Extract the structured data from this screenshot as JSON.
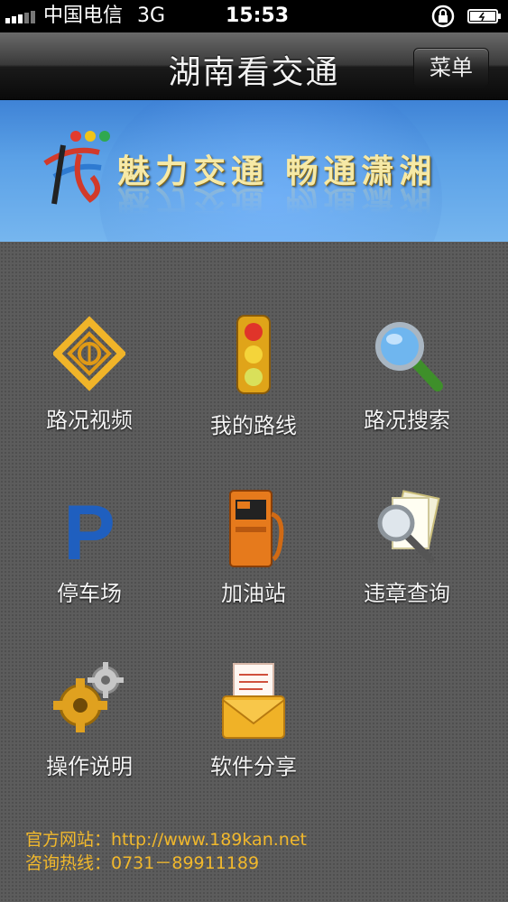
{
  "status_bar": {
    "carrier": "中国电信",
    "network": "3G",
    "time": "15:53"
  },
  "nav": {
    "title": "湖南看交通",
    "menu_label": "菜单"
  },
  "banner": {
    "slogan": "魅力交通 畅通潇湘"
  },
  "grid": {
    "items": [
      {
        "label": "路况视频",
        "icon": "video-camera-icon"
      },
      {
        "label": "我的路线",
        "icon": "traffic-light-icon"
      },
      {
        "label": "路况搜索",
        "icon": "magnifier-icon"
      },
      {
        "label": "停车场",
        "icon": "parking-icon"
      },
      {
        "label": "加油站",
        "icon": "fuel-pump-icon"
      },
      {
        "label": "违章查询",
        "icon": "document-search-icon"
      },
      {
        "label": "操作说明",
        "icon": "gears-icon"
      },
      {
        "label": "软件分享",
        "icon": "envelope-icon"
      }
    ]
  },
  "footer": {
    "website": "官方网站：http://www.189kan.net",
    "hotline": "咨询热线：0731－89911189"
  },
  "colors": {
    "footer_text": "#f1b82c",
    "banner_blue": "#4a90e2"
  }
}
